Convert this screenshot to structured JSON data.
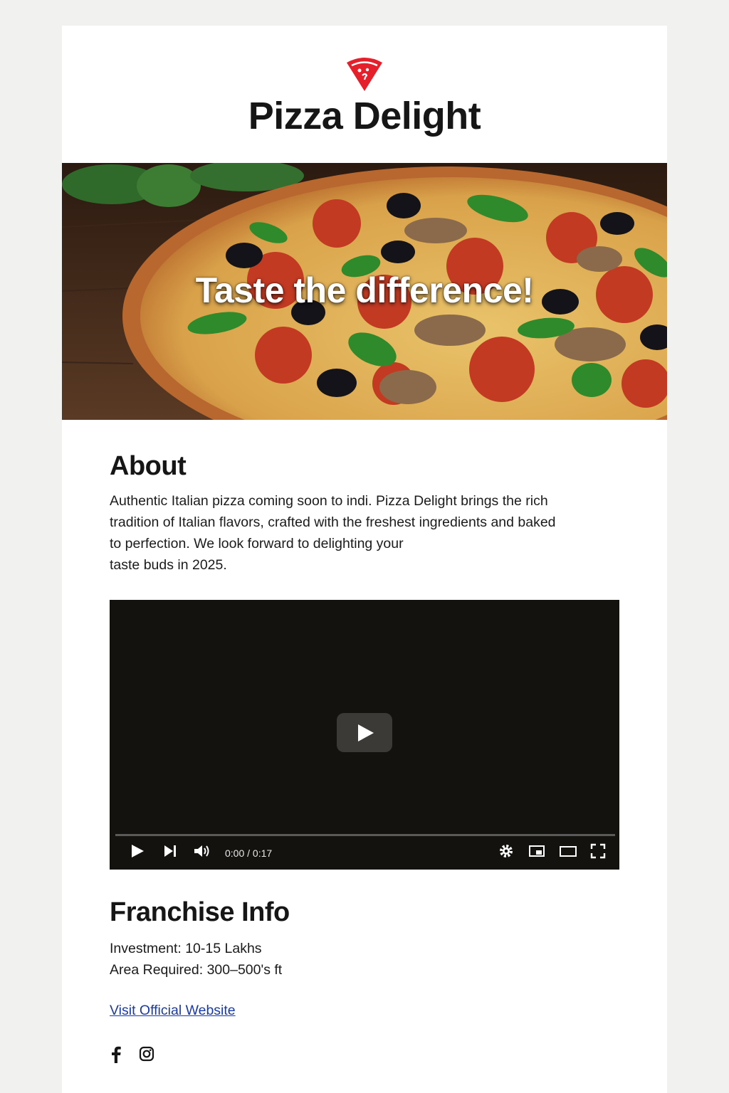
{
  "header": {
    "brand": "Pizza Delight",
    "logo_icon": "pizza-slice-icon",
    "logo_color": "#e5202b"
  },
  "hero": {
    "tagline": "Taste the difference!"
  },
  "about": {
    "title": "About",
    "lines": [
      "Authentic Italian pizza coming soon to indi. Pizza Delight brings the rich",
      "tradition of Italian flavors, crafted with the freshest ingredients and baked",
      "to perfection. We look forward to delighting your",
      "taste buds in 2025."
    ]
  },
  "video": {
    "time": "0:00 / 0:17",
    "controls": [
      "play-icon",
      "next-icon",
      "volume-icon",
      "settings-icon",
      "miniplayer-icon",
      "theater-icon",
      "fullscreen-icon"
    ]
  },
  "franchise": {
    "title": "Franchise Info",
    "investment": "Investment: 10-15 Lakhs",
    "area": "Area Required: 300–500's ft",
    "link": "Visit Official Website"
  },
  "social": [
    "facebook-icon",
    "instagram-icon"
  ]
}
